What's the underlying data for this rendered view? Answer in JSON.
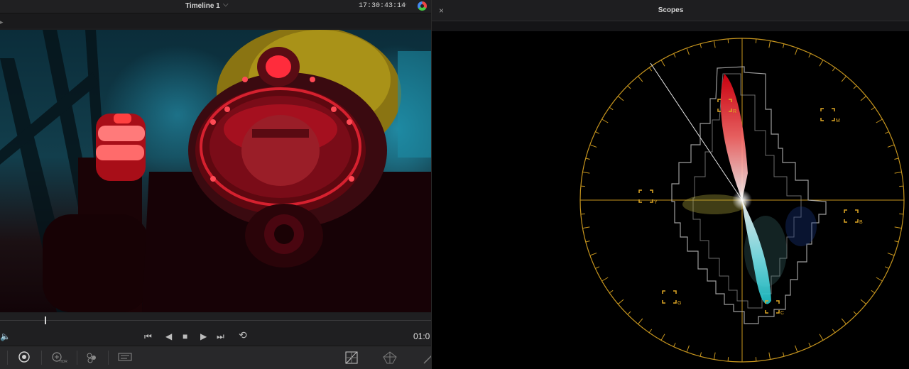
{
  "viewer": {
    "timeline_title": "Timeline 1",
    "timeline_chevron": "⌵",
    "timecode": "17:30:43:14",
    "timecode_chevron": "⌵",
    "end_timecode": "01:0",
    "playhead_fraction": 0.103
  },
  "transport": {
    "volume_icon": "🔈",
    "skip_back": "⏮",
    "step_back": "◀",
    "stop": "■",
    "play": "▶",
    "skip_forward": "⏭",
    "loop": "⟲"
  },
  "toolbar": {
    "hdr_sub_label": "HDR"
  },
  "scopes": {
    "title": "Scopes",
    "close_glyph": "×",
    "targets": [
      {
        "label": "R"
      },
      {
        "label": "M"
      },
      {
        "label": "Y"
      },
      {
        "label": "B"
      },
      {
        "label": "G"
      },
      {
        "label": "C"
      }
    ],
    "graticule_color": "#c8961e",
    "target_color": "#e0a825"
  }
}
